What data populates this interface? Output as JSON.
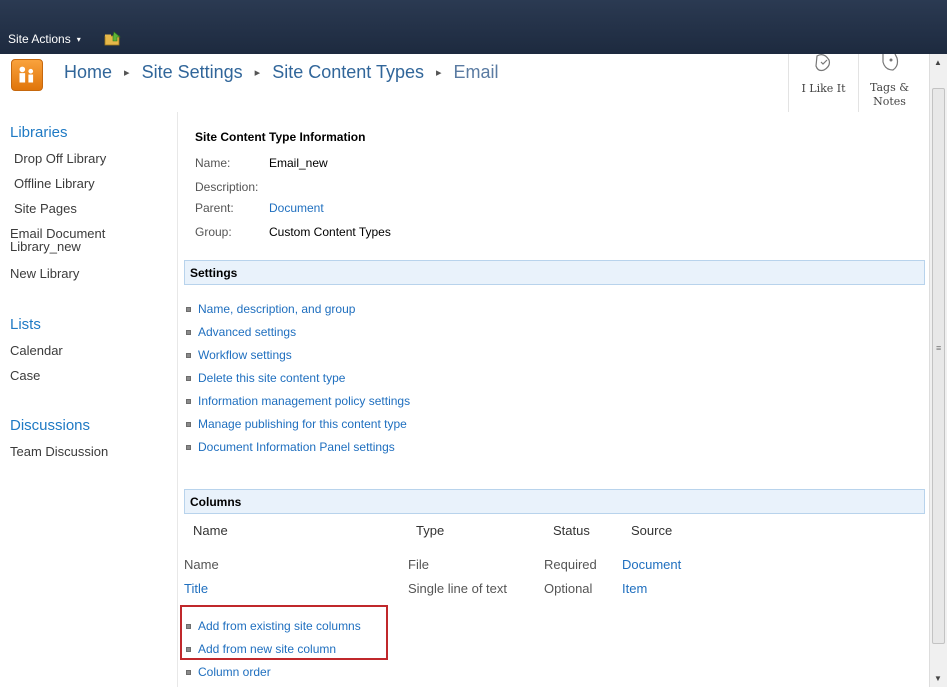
{
  "top_bar": {
    "site_actions_label": "Site Actions",
    "site_actions_caret": "▾",
    "navigate_icon": "folder-up-arrow-icon"
  },
  "breadcrumb": {
    "items": [
      "Home",
      "Site Settings",
      "Site Content Types",
      "Email"
    ],
    "separator": "▸"
  },
  "social": {
    "like_label": "I Like It",
    "tags_label_line1": "Tags &",
    "tags_label_line2": "Notes"
  },
  "left_nav": {
    "libraries_heading": "Libraries",
    "libraries": [
      "Drop Off Library",
      "Offline Library",
      "Site Pages",
      "Email Document",
      "Library_new",
      "New Library"
    ],
    "lists_heading": "Lists",
    "lists": [
      "Calendar",
      "Case"
    ],
    "discussions_heading": "Discussions",
    "discussions": [
      "Team Discussion"
    ]
  },
  "info": {
    "title": "Site Content Type Information",
    "name_label": "Name:",
    "name_value": "Email_new",
    "description_label": "Description:",
    "parent_label": "Parent:",
    "parent_value": "Document",
    "group_label": "Group:",
    "group_value": "Custom Content Types"
  },
  "settings": {
    "heading": "Settings",
    "links": [
      "Name, description, and group",
      "Advanced settings",
      "Workflow settings",
      "Delete this site content type",
      "Information management policy settings",
      "Manage publishing for this content type",
      "Document Information Panel settings"
    ]
  },
  "columns": {
    "heading": "Columns",
    "headers": [
      "Name",
      "Type",
      "Status",
      "Source"
    ],
    "rows": [
      {
        "name": "Name",
        "type": "File",
        "status": "Required",
        "source": "Document"
      },
      {
        "name": "Title",
        "type": "Single line of text",
        "status": "Optional",
        "source": "Item"
      }
    ],
    "actions": [
      "Add from existing site columns",
      "Add from new site column",
      "Column order"
    ]
  },
  "colors": {
    "top_bar": "#1d2a3f",
    "link": "#1f6fbf",
    "nav_heading": "#1f7ac4",
    "section_bar": "#e9f2fb",
    "highlight": "#c0282b"
  }
}
